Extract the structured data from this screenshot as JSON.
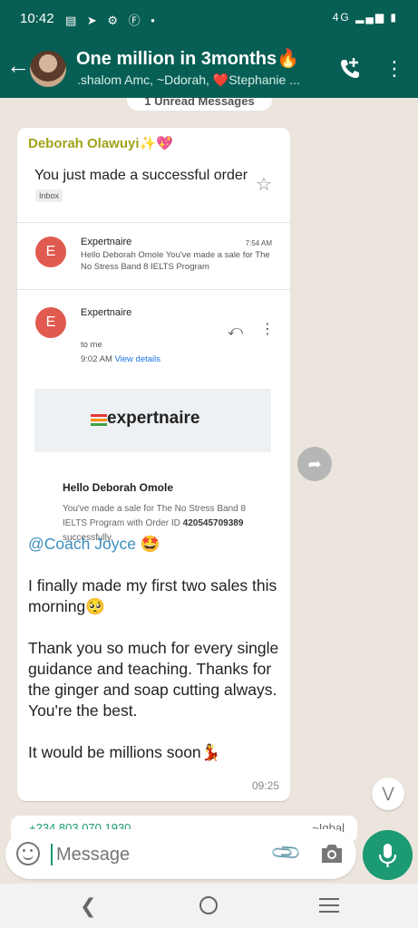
{
  "status": {
    "time": "10:42",
    "left_icons": "▤ ➤ ⚙ Ⓕ •",
    "network": "4G",
    "right_icons": "▂▄▆ ▮"
  },
  "header": {
    "title": "One million in 3months🔥",
    "subtitle": ".shalom Amc, ~Ddorah, ❤️Stephanie ..."
  },
  "unread_pill": "1 Unread Messages",
  "message": {
    "sender": "Deborah Olawuyi✨💖",
    "screenshot": {
      "subject": "You just made a successful order",
      "inbox_tag": "Inbox",
      "item1": {
        "avatar_letter": "E",
        "from": "Expertnaire",
        "time": "7:54 AM",
        "snippet": "Hello Deborah Omole You've made a sale for The No Stress Band 8 IELTS Program"
      },
      "item2": {
        "avatar_letter": "E",
        "from": "Expertnaire",
        "to": "to me",
        "time": "9:02 AM",
        "view_details": "View details"
      },
      "logo_text": "expertnaire",
      "logo_colors": [
        "#e53935",
        "#fb8c00",
        "#43a047"
      ],
      "hello": "Hello Deborah Omole",
      "sale_text_pre": "You've made a sale for The No Stress Band 8 IELTS Program with Order ID",
      "order_id": "420545709389",
      "sale_text_post": "successfully."
    },
    "mention": "@Coach Joyce 🤩",
    "para1": "I finally made my first two sales this morning🥺",
    "para2": "Thank you so much for every single guidance and teaching. Thanks for the ginger and soap cutting always. You're the best.",
    "para3": "It would be millions soon💃",
    "time": "09:25"
  },
  "next_message": {
    "phone": "+234 803 070 1930",
    "name": "~Iqbal"
  },
  "input": {
    "placeholder": "Message"
  },
  "colors": {
    "header": "#075e54",
    "accent": "#1b9a73",
    "sender": "#a0a31a",
    "mention": "#3b8dbd"
  }
}
